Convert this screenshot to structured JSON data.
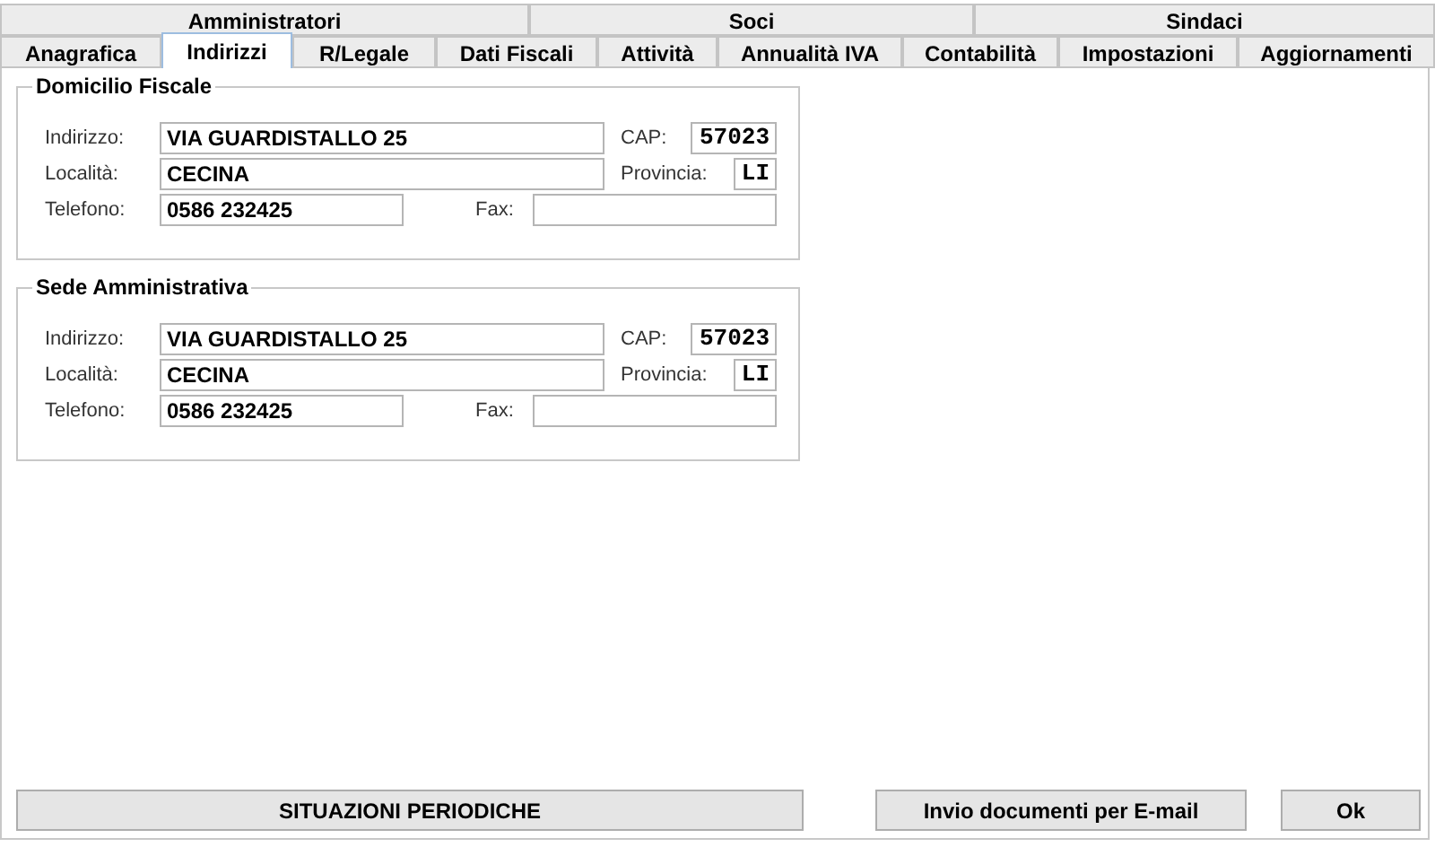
{
  "tab_rows": [
    [
      {
        "label": "Amministratori",
        "selected": false
      },
      {
        "label": "Soci",
        "selected": false
      },
      {
        "label": "Sindaci",
        "selected": false
      }
    ],
    [
      {
        "label": "Anagrafica",
        "selected": false
      },
      {
        "label": "Indirizzi",
        "selected": true
      },
      {
        "label": "R/Legale",
        "selected": false
      },
      {
        "label": "Dati Fiscali",
        "selected": false
      },
      {
        "label": "Attività",
        "selected": false
      },
      {
        "label": "Annualità IVA",
        "selected": false
      },
      {
        "label": "Contabilità",
        "selected": false
      },
      {
        "label": "Impostazioni",
        "selected": false
      },
      {
        "label": "Aggiornamenti",
        "selected": false
      }
    ]
  ],
  "groups": [
    {
      "title": "Domicilio Fiscale",
      "indirizzo": {
        "label": "Indirizzo:",
        "value": "VIA GUARDISTALLO 25"
      },
      "cap": {
        "label": "CAP:",
        "value": "57023"
      },
      "localita": {
        "label": "Località:",
        "value": "CECINA"
      },
      "provincia": {
        "label": "Provincia:",
        "value": "LI"
      },
      "telefono": {
        "label": "Telefono:",
        "value": "0586 232425"
      },
      "fax": {
        "label": "Fax:"
      }
    },
    {
      "title": "Sede Amministrativa",
      "indirizzo": {
        "label": "Indirizzo:",
        "value": "VIA GUARDISTALLO 25"
      },
      "cap": {
        "label": "CAP:",
        "value": "57023"
      },
      "localita": {
        "label": "Località:",
        "value": "CECINA"
      },
      "provincia": {
        "label": "Provincia:",
        "value": "LI"
      },
      "telefono": {
        "label": "Telefono:",
        "value": "0586 232425"
      },
      "fax": {
        "label": "Fax:"
      }
    }
  ],
  "buttons": {
    "situazioni": "SITUAZIONI PERIODICHE",
    "invio": "Invio documenti per E-mail",
    "ok": "Ok"
  }
}
